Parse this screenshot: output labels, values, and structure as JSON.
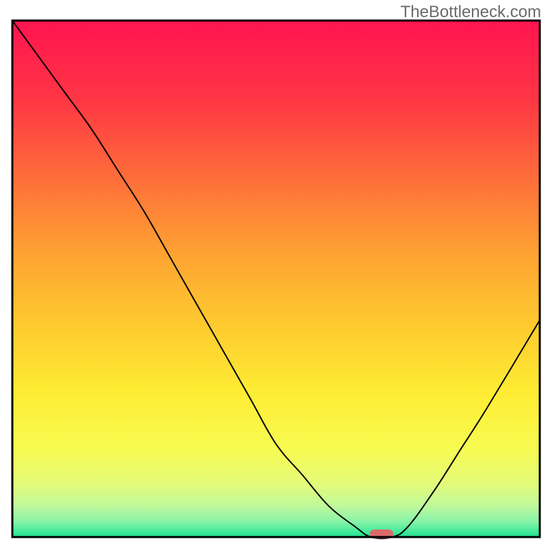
{
  "watermark": "TheBottleneck.com",
  "chart_data": {
    "type": "line",
    "title": "",
    "xlabel": "",
    "ylabel": "",
    "xlim": [
      0,
      100
    ],
    "ylim": [
      0,
      100
    ],
    "x": [
      0,
      5,
      10,
      15,
      20,
      25,
      30,
      35,
      40,
      45,
      50,
      55,
      60,
      65,
      68,
      72,
      75,
      80,
      85,
      90,
      100
    ],
    "values": [
      100,
      93,
      86,
      79,
      71,
      63,
      54,
      45,
      36,
      27,
      18,
      12,
      6,
      2,
      0,
      0,
      2,
      9,
      17,
      25,
      42
    ],
    "marker": {
      "x": 70,
      "y": 0,
      "color": "#da6b6b"
    },
    "gradient_stops": [
      {
        "offset": 0.0,
        "color": "#ff1450"
      },
      {
        "offset": 0.15,
        "color": "#ff3545"
      },
      {
        "offset": 0.3,
        "color": "#fe6c3a"
      },
      {
        "offset": 0.45,
        "color": "#fea232"
      },
      {
        "offset": 0.6,
        "color": "#fecd2f"
      },
      {
        "offset": 0.72,
        "color": "#feec33"
      },
      {
        "offset": 0.83,
        "color": "#f7fb51"
      },
      {
        "offset": 0.9,
        "color": "#e2fb7b"
      },
      {
        "offset": 0.94,
        "color": "#bff99b"
      },
      {
        "offset": 0.97,
        "color": "#88f3a9"
      },
      {
        "offset": 0.998,
        "color": "#25e592"
      },
      {
        "offset": 1.0,
        "color": "#1be28e"
      }
    ],
    "notes": "y-values approximate a bottleneck curve dropping from 100% at x=0, reaching 0 at roughly x=68-72, then rising to about 42% at x=100; values are visual estimates."
  }
}
